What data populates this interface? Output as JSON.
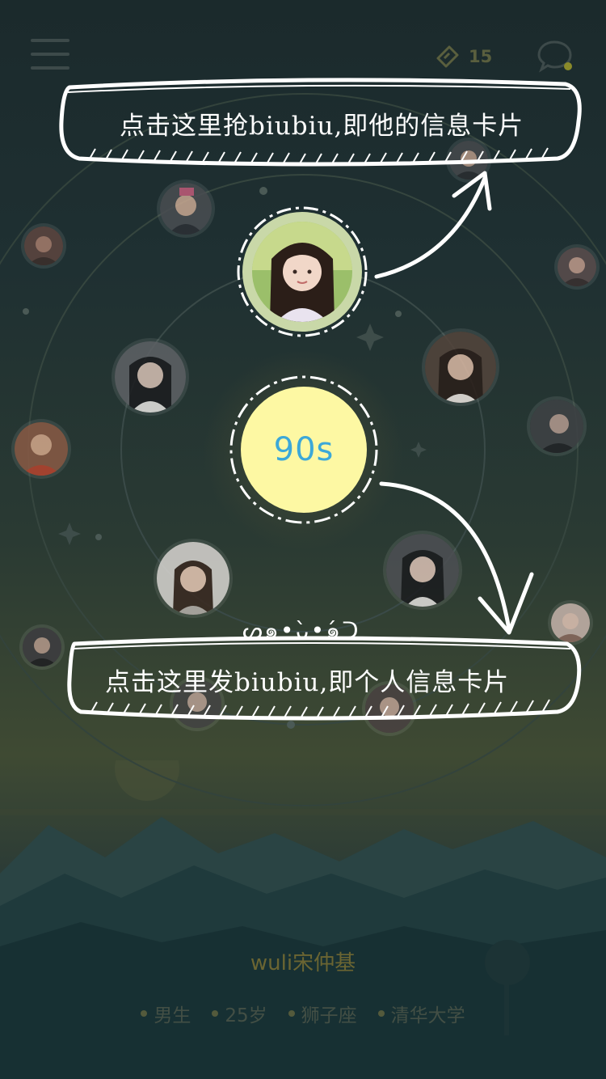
{
  "header": {
    "menu_icon": "menu-icon",
    "ticket_icon": "ticket-icon",
    "ticket_count": "15",
    "chat_icon": "chat-bubble-icon"
  },
  "center": {
    "label": "90s"
  },
  "callouts": {
    "top": "点击这里抢biubiu,即他的信息卡片",
    "bottom": "点击这里发biubiu,即个人信息卡片",
    "kaomoji": "ᔕ๑•̀ᴗ•́๑ᑐ"
  },
  "profile": {
    "name": "wuli宋仲基",
    "tags": [
      "男生",
      "25岁",
      "狮子座",
      "清华大学"
    ]
  },
  "colors": {
    "sun": "#fdf8a3",
    "sun_text": "#3ca8d8",
    "featured_ring": "#c9d8a8"
  }
}
